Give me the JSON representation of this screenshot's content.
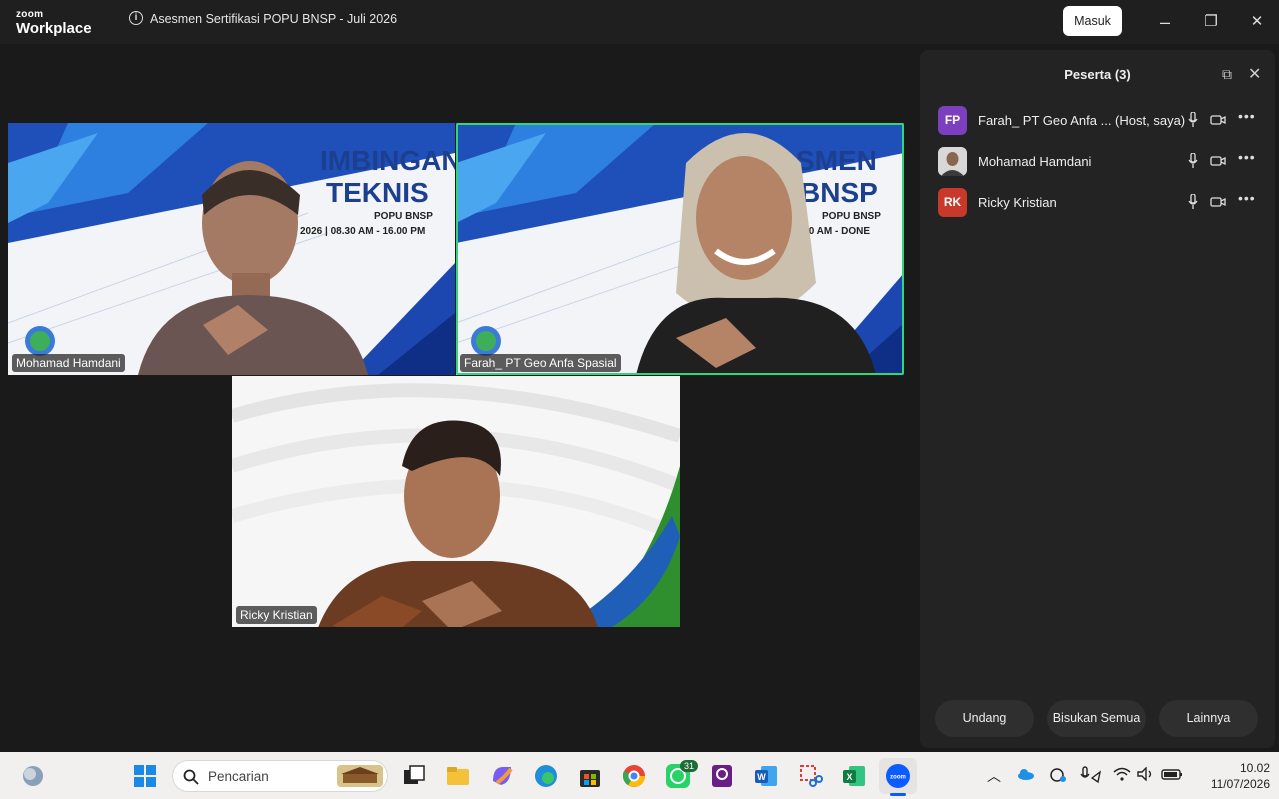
{
  "titlebar": {
    "logo_top": "zoom",
    "logo_bottom": "Workplace",
    "meeting_title": "Asesmen Sertifikasi POPU BNSP - Juli 2026",
    "join_button": "Masuk",
    "minimize": "–",
    "restore": "❐",
    "close": "✕"
  },
  "tiles": [
    {
      "name": "Mohamad Hamdani",
      "banner_line1": "IMBINGAN",
      "banner_line2": "TEKNIS",
      "banner_sub": "POPU BNSP",
      "banner_time": "2026 | 08.30 AM - 16.00 PM"
    },
    {
      "name": "Farah_ PT Geo Anfa Spasial",
      "banner_line1": "SMEN",
      "banner_line2": "BNSP",
      "banner_sub": "POPU BNSP",
      "banner_time": "6 |10  AM - DONE",
      "active_speaker": true
    },
    {
      "name": "Ricky Kristian"
    }
  ],
  "panel": {
    "title": "Peserta (3)",
    "participants": [
      {
        "initials": "FP",
        "name": "Farah_ PT Geo Anfa ...  (Host, saya)",
        "avatar_color": "#7b3fbf"
      },
      {
        "initials": "",
        "name": "Mohamad Hamdani",
        "avatar_color": "#6b6b6b"
      },
      {
        "initials": "RK",
        "name": "Ricky Kristian",
        "avatar_color": "#c8392b"
      }
    ],
    "buttons": {
      "invite": "Undang",
      "mute_all": "Bisukan Semua",
      "more": "Lainnya"
    }
  },
  "taskbar": {
    "search_placeholder": "Pencarian",
    "whatsapp_badge": "31",
    "time": "10.02",
    "date": "11/07/2026"
  }
}
